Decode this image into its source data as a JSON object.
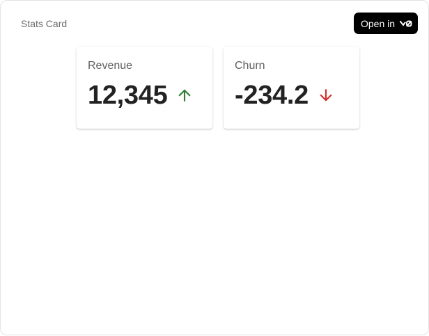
{
  "header": {
    "title": "Stats Card",
    "open_button_label": "Open in"
  },
  "stats": [
    {
      "label": "Revenue",
      "value": "12,345",
      "trend": "up",
      "trend_icon": "arrow-up-icon",
      "trend_color": "#2e7d32"
    },
    {
      "label": "Churn",
      "value": "-234.2",
      "trend": "down",
      "trend_icon": "arrow-down-icon",
      "trend_color": "#d32f2f"
    }
  ],
  "colors": {
    "background": "#ffffff",
    "button_background": "#000000",
    "value_text": "#222222",
    "label_text": "#5f5f5f"
  }
}
